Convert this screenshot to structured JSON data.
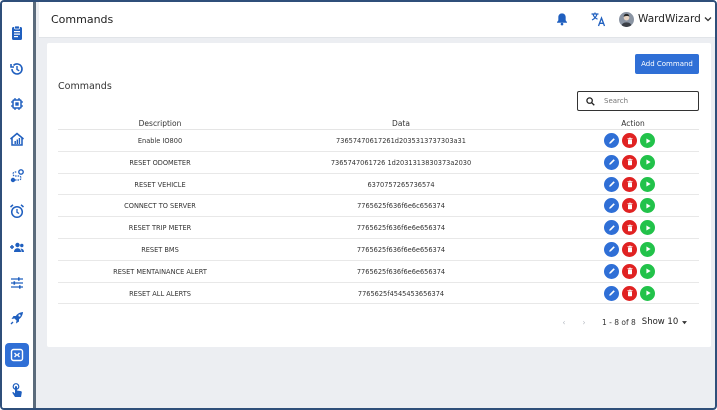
{
  "header": {
    "title": "Commands",
    "user_name": "WardWizard"
  },
  "sidebar": {
    "items": [
      {
        "icon": "clipboard-icon"
      },
      {
        "icon": "history-icon"
      },
      {
        "icon": "chip-icon"
      },
      {
        "icon": "home-chart-icon"
      },
      {
        "icon": "route-icon"
      },
      {
        "icon": "alarm-icon"
      },
      {
        "icon": "add-group-icon"
      },
      {
        "icon": "sliders-icon"
      },
      {
        "icon": "rocket-icon"
      },
      {
        "icon": "command-icon",
        "active": true
      },
      {
        "icon": "touch-icon"
      }
    ]
  },
  "main": {
    "card_title": "Commands",
    "add_button": "Add Command",
    "search_placeholder": "Search",
    "columns": {
      "description": "Description",
      "data": "Data",
      "action": "Action"
    },
    "rows": [
      {
        "description": "Enable IO800",
        "data": "73657470617261d2035313737303a31"
      },
      {
        "description": "RESET ODOMETER",
        "data": "7365747061726 1d2031313830373a2030"
      },
      {
        "description": "RESET VEHICLE",
        "data": "6370757265736574"
      },
      {
        "description": "CONNECT TO SERVER",
        "data": "7765625f636f6e6c656374"
      },
      {
        "description": "RESET TRIP METER",
        "data": "7765625f636f6e6e656374"
      },
      {
        "description": "RESET BMS",
        "data": "7765625f636f6e6e656374"
      },
      {
        "description": "RESET MENTAINANCE ALERT",
        "data": "7765625f636f6e6e656374"
      },
      {
        "description": "RESET ALL ALERTS",
        "data": "7765625f4545453656374"
      }
    ],
    "pagination": {
      "info": "1 - 8 of 8",
      "show": "Show 10"
    }
  },
  "colors": {
    "primary": "#2f6fd6",
    "delete": "#e02222",
    "run": "#22c24a",
    "sidebar_icon": "#1f5fbf"
  }
}
